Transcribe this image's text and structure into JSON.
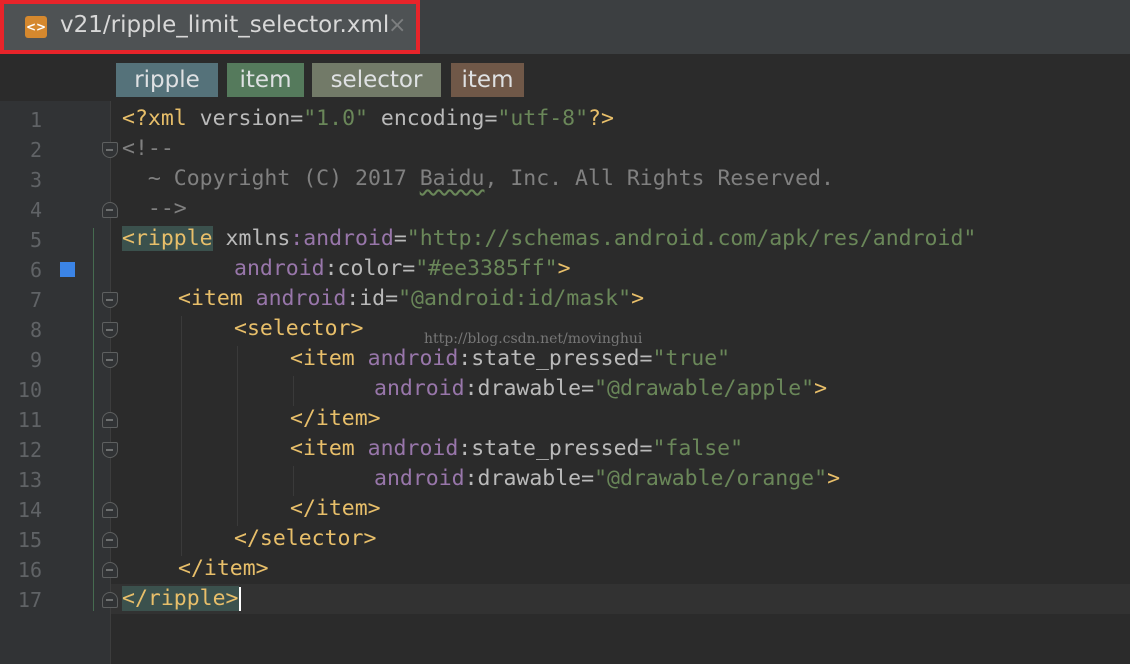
{
  "tab": {
    "file_name": "v21/ripple_limit_selector.xml",
    "close_glyph": "×",
    "icon_glyph": "<>"
  },
  "breadcrumbs": [
    "ripple",
    "item",
    "selector",
    "item"
  ],
  "line_numbers": [
    "1",
    "2",
    "3",
    "4",
    "5",
    "6",
    "7",
    "8",
    "9",
    "10",
    "11",
    "12",
    "13",
    "14",
    "15",
    "16",
    "17"
  ],
  "code": {
    "l1": {
      "a": "<?xml ",
      "b": "version",
      "c": "=",
      "d": "\"1.0\"",
      "e": " encoding",
      "f": "=",
      "g": "\"utf-8\"",
      "h": "?>"
    },
    "l2": "<!--",
    "l3a": "  ~ Copyright (C) 2017 ",
    "l3b": "Baidu",
    "l3c": ", Inc. All Rights Reserved.",
    "l4": "  -->",
    "l5": {
      "a": "<ripple",
      "b": " xmlns",
      "c": ":android",
      "d": "=",
      "e": "\"http://schemas.android.com/apk/res/android\""
    },
    "l6": {
      "a": "android",
      "b": ":color",
      "c": "=",
      "d": "\"#ee3385ff\"",
      "e": ">"
    },
    "l7": {
      "a": "<item ",
      "b": "android",
      "c": ":id",
      "d": "=",
      "e": "\"@android:id/mask\"",
      "f": ">"
    },
    "l8": "<selector>",
    "l9": {
      "a": "<item ",
      "b": "android",
      "c": ":state_pressed",
      "d": "=",
      "e": "\"true\""
    },
    "l10": {
      "a": "android",
      "b": ":drawable",
      "c": "=",
      "d": "\"@drawable/apple\"",
      "e": ">"
    },
    "l11": "</item>",
    "l12": {
      "a": "<item ",
      "b": "android",
      "c": ":state_pressed",
      "d": "=",
      "e": "\"false\""
    },
    "l13": {
      "a": "android",
      "b": ":drawable",
      "c": "=",
      "d": "\"@drawable/orange\"",
      "e": ">"
    },
    "l14": "</item>",
    "l15": "</selector>",
    "l16": "</item>",
    "l17": "</ripple>"
  },
  "watermark": "http://blog.csdn.net/movinghui",
  "colors": {
    "crumb_ripple": "#55727a",
    "crumb_item": "#557a5c",
    "crumb_selector": "#727a68",
    "crumb_item2": "#705848",
    "tab_highlight": "#e8242a"
  }
}
